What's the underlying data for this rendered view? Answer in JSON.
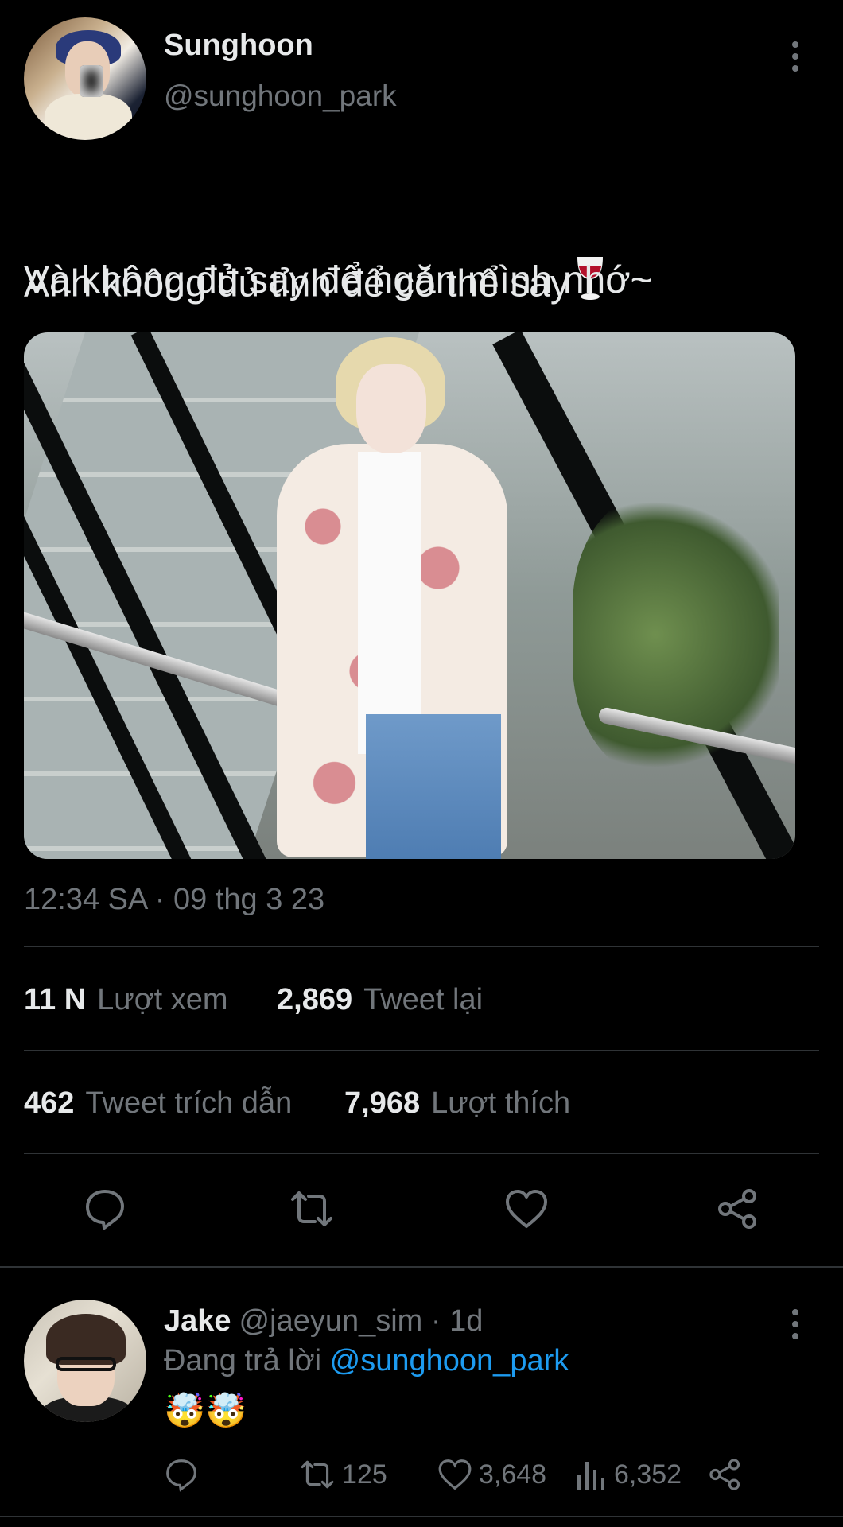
{
  "tweet": {
    "author_name": "Sunghoon",
    "author_handle": "@sunghoon_park",
    "text_line1": "Anh không đủ tỉnh để có thể say",
    "text_line2": "Và không đủ say để ngăn mình nhớ~",
    "emoji_icon": "wine-glass-icon",
    "timestamp": "12:34 SA · 09 thg 3 23",
    "stats_row1": [
      {
        "value": "11 N",
        "label": "Lượt xem"
      },
      {
        "value": "2,869",
        "label": "Tweet lại"
      }
    ],
    "stats_row2": [
      {
        "value": "462",
        "label": "Tweet trích dẫn"
      },
      {
        "value": "7,968",
        "label": "Lượt thích"
      }
    ],
    "actions": [
      "reply-icon",
      "retweet-icon",
      "like-icon",
      "share-icon"
    ]
  },
  "reply": {
    "author_name": "Jake",
    "author_handle": "@jaeyun_sim",
    "time": "· 1d",
    "replying_prefix": "Đang trả lời",
    "replying_to": "@sunghoon_park",
    "emojis": "🤯🤯",
    "retweets": "125",
    "likes": "3,648",
    "views": "6,352"
  },
  "colors": {
    "background": "#000000",
    "text": "#e7e9ea",
    "muted": "#71767b",
    "link": "#1d9bf0",
    "divider": "#2f3336"
  }
}
